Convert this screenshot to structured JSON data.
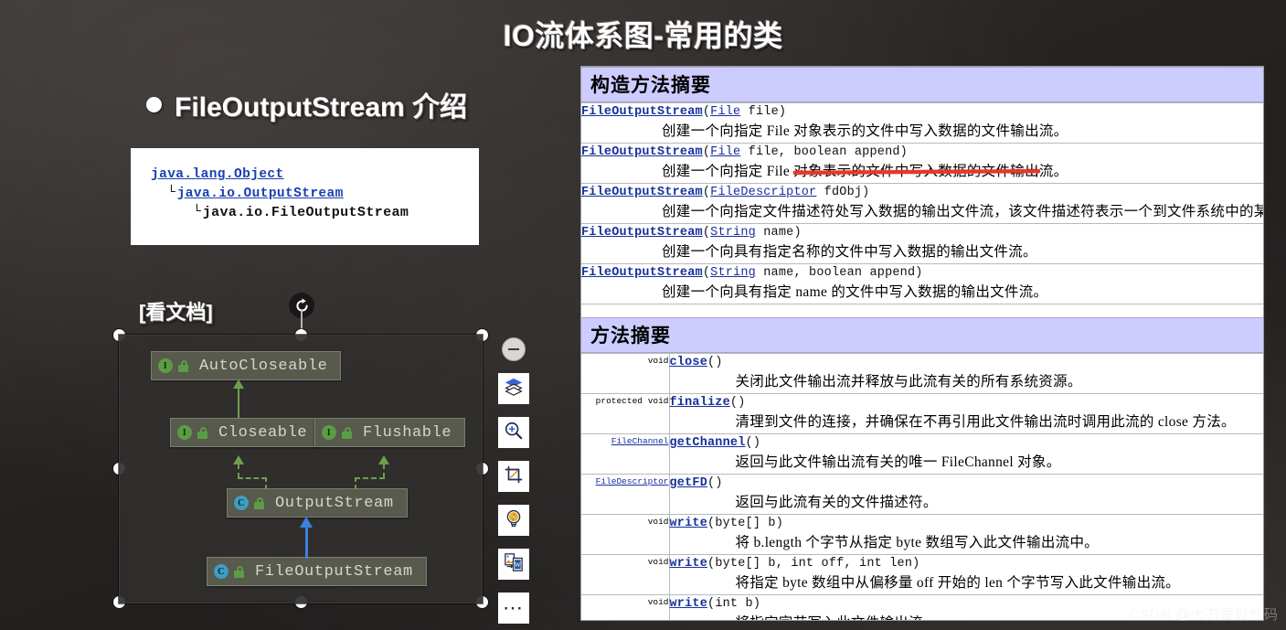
{
  "slide": {
    "title": "IO流体系图-常用的类",
    "heading": "FileOutputStream 介绍",
    "doc_hint": "[看文档]",
    "watermark": "CSDN @大刀爱敲代码"
  },
  "hierarchy": {
    "rows": [
      {
        "text": "java.lang.Object",
        "kind": "link",
        "corner": ""
      },
      {
        "text": "java.io.OutputStream",
        "kind": "link",
        "corner": "└"
      },
      {
        "text": "java.io.FileOutputStream",
        "kind": "leaf",
        "corner": "└"
      }
    ]
  },
  "uml": {
    "nodes": [
      {
        "name": "AutoCloseable",
        "badge": "I",
        "kind": "interface"
      },
      {
        "name": "Closeable",
        "badge": "I",
        "kind": "interface"
      },
      {
        "name": "Flushable",
        "badge": "I",
        "kind": "interface"
      },
      {
        "name": "OutputStream",
        "badge": "C",
        "kind": "abstract-class"
      },
      {
        "name": "FileOutputStream",
        "badge": "C",
        "kind": "class"
      }
    ],
    "colors": {
      "interface_badge": "#5c9c46",
      "class_badge": "#3e9ec4",
      "node_fill": "#575a4d",
      "extends_arrow": "#6f9e4e",
      "inherit_arrow": "#3c80e0"
    },
    "toolbar": [
      {
        "name": "collapse",
        "icon": "minus-circle-icon"
      },
      {
        "name": "layers",
        "icon": "layers-icon"
      },
      {
        "name": "zoom-in",
        "icon": "magnifier-plus-icon"
      },
      {
        "name": "crop",
        "icon": "crop-icon"
      },
      {
        "name": "idea",
        "icon": "lightbulb-icon"
      },
      {
        "name": "copy-to-doc",
        "icon": "copy-document-icon"
      },
      {
        "name": "more",
        "icon": "ellipsis-icon"
      }
    ]
  },
  "doc": {
    "constructor_section_title": "构造方法摘要",
    "method_section_title": "方法摘要",
    "constructors": [
      {
        "method": "FileOutputStream",
        "param_type": "File",
        "param_rest": " file)",
        "desc": "创建一个向指定 File 对象表示的文件中写入数据的文件输出流。"
      },
      {
        "method": "FileOutputStream",
        "param_type": "File",
        "param_rest": " file, boolean append)",
        "desc": "创建一个向指定 File 对象表示的文件中写入数据的文件输出流。"
      },
      {
        "method": "FileOutputStream",
        "param_type": "FileDescriptor",
        "param_rest": " fdObj)",
        "desc": "创建一个向指定文件描述符处写入数据的输出文件流，该文件描述符表示一个到文件系统中的某个"
      },
      {
        "method": "FileOutputStream",
        "param_type": "String",
        "param_rest": " name)",
        "desc": "创建一个向具有指定名称的文件中写入数据的输出文件流。"
      },
      {
        "method": "FileOutputStream",
        "param_type": "String",
        "param_rest": " name, boolean append)",
        "desc": "创建一个向具有指定 name 的文件中写入数据的输出文件流。"
      }
    ],
    "methods": [
      {
        "modifier": "",
        "return_type": "void",
        "return_is_link": false,
        "method": "close",
        "params": "()",
        "desc": "关闭此文件输出流并释放与此流有关的所有系统资源。"
      },
      {
        "modifier": "protected",
        "return_type": "void",
        "return_is_link": false,
        "method": "finalize",
        "params": "()",
        "desc": "清理到文件的连接，并确保在不再引用此文件输出流时调用此流的 close 方法。"
      },
      {
        "modifier": "",
        "return_type": "FileChannel",
        "return_is_link": true,
        "method": "getChannel",
        "params": "()",
        "desc": "返回与此文件输出流有关的唯一 FileChannel 对象。"
      },
      {
        "modifier": "",
        "return_type": "FileDescriptor",
        "return_is_link": true,
        "method": "getFD",
        "params": "()",
        "desc": "返回与此流有关的文件描述符。"
      },
      {
        "modifier": "",
        "return_type": "void",
        "return_is_link": false,
        "method": "write",
        "params": "(byte[] b)",
        "desc": "将 b.length 个字节从指定 byte 数组写入此文件输出流中。"
      },
      {
        "modifier": "",
        "return_type": "void",
        "return_is_link": false,
        "method": "write",
        "params": "(byte[] b, int off, int len)",
        "desc": "将指定 byte 数组中从偏移量 off 开始的 len 个字节写入此文件输出流。"
      },
      {
        "modifier": "",
        "return_type": "void",
        "return_is_link": false,
        "method": "write",
        "params": "(int b)",
        "desc": "将指定字节写入此文件输出流。"
      }
    ],
    "annotation": {
      "type": "red-underline",
      "color": "#e8372b"
    }
  }
}
